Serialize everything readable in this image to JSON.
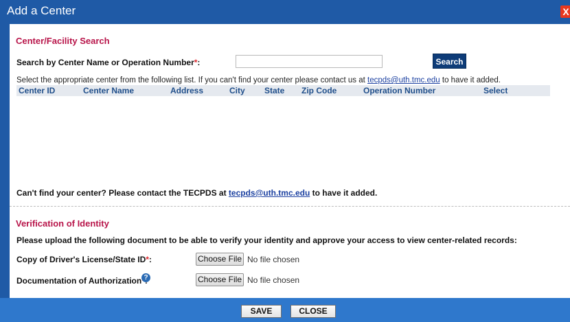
{
  "dialog": {
    "title": "Add a Center",
    "close_glyph": "X"
  },
  "search_section": {
    "title": "Center/Facility Search",
    "label": "Search by Center Name or Operation Number",
    "required_mark": "*",
    "colon": ":",
    "input_value": "",
    "button": "Search",
    "instructions_prefix": "Select the appropriate center from the following list. If you can't find your center please contact us at ",
    "instructions_email": "tecpds@uth.tmc.edu",
    "instructions_suffix": " to have it added."
  },
  "table": {
    "columns": [
      "Center ID",
      "Center Name",
      "Address",
      "City",
      "State",
      "Zip Code",
      "Operation Number",
      "Select"
    ],
    "rows": []
  },
  "cant_find": {
    "prefix": "Can't find your center? Please contact the TECPDS at ",
    "email": "tecpds@uth.tmc.edu",
    "suffix": " to have it added."
  },
  "verification": {
    "title": "Verification of Identity",
    "instructions": "Please upload the following document to be able to verify your identity and approve your access to view center-related records:",
    "fields": [
      {
        "label": "Copy of Driver's License/State ID",
        "required_mark": "*",
        "colon": ":",
        "button": "Choose File",
        "status": "No file chosen"
      },
      {
        "label": "Documentation of Authorization",
        "required_mark": "*",
        "colon": ":",
        "button": "Choose File",
        "status": "No file chosen",
        "help_icon": "?"
      }
    ]
  },
  "footer": {
    "save": "SAVE",
    "close": "CLOSE"
  },
  "colors": {
    "titlebar": "#1f5aa6",
    "footer": "#2f78cc",
    "section_title": "#b8154a",
    "header_text": "#1f4e8a",
    "search_button": "#0e3c78"
  }
}
